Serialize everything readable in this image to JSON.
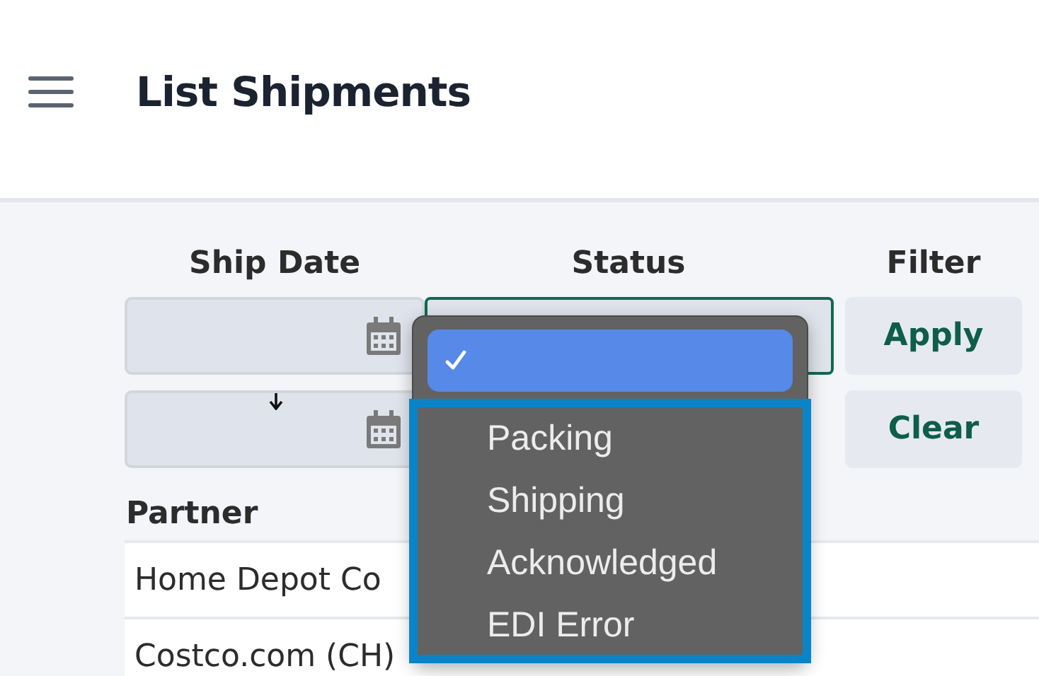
{
  "header": {
    "title": "List Shipments"
  },
  "filters": {
    "columns": [
      "Ship Date",
      "Status",
      "Filter"
    ],
    "buttons": [
      {
        "label": "Apply"
      },
      {
        "label": "Clear"
      }
    ],
    "status_dropdown": {
      "expanded": true,
      "options": [
        {
          "selected": true
        },
        {
          "label": "Packing",
          "selected": false
        },
        {
          "label": "Shipping",
          "selected": false
        },
        {
          "label": "Acknowledged",
          "selected": false
        },
        {
          "label": "EDI Error",
          "selected": false
        }
      ]
    }
  },
  "table": {
    "columns": [
      "Partner"
    ],
    "rows": [
      [
        "Home Depot Co"
      ],
      [
        "Costco.com (CH)"
      ]
    ]
  }
}
